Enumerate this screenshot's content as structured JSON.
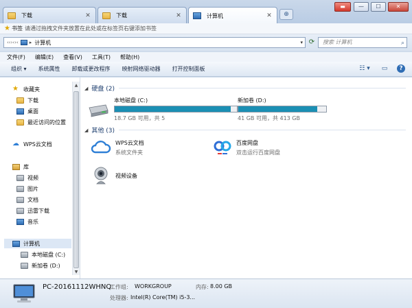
{
  "tabs": [
    {
      "label": "下载",
      "close": "✕",
      "icon": "folder-icon"
    },
    {
      "label": "下载",
      "close": "✕",
      "icon": "folder-icon"
    },
    {
      "label": "计算机",
      "close": "✕",
      "icon": "computer-icon"
    }
  ],
  "new_tab": "⊕",
  "window_controls": {
    "minimize": "—",
    "maximize": "☐",
    "close": "✕",
    "extra": "▬"
  },
  "bookmarks": {
    "label": "书签",
    "hint": "请通过拖拽文件夹放置在此处或在标签页右键添加书签"
  },
  "address": {
    "prefix": "‹‹›‹›‹",
    "separator": "▸",
    "path": "计算机",
    "dropdown": "▾"
  },
  "search": {
    "placeholder": "搜索 计算机",
    "icon": "⌕"
  },
  "menu": [
    "文件(F)",
    "编辑(E)",
    "查看(V)",
    "工具(T)",
    "帮助(H)"
  ],
  "commands": [
    "组织 ▾",
    "系统属性",
    "卸载或更改程序",
    "映射网络驱动器",
    "打开控制面板"
  ],
  "toolbar_icons": {
    "view": "☷ ▾",
    "preview": "▭",
    "help": "?"
  },
  "nav": {
    "favorites": "收藏夹",
    "downloads": "下载",
    "desktop": "桌面",
    "recent": "最近访问的位置",
    "wps": "WPS云文档",
    "libraries": "库",
    "videos": "视频",
    "pictures": "图片",
    "documents": "文档",
    "xunlei": "迅雷下载",
    "music": "音乐",
    "computer": "计算机",
    "local_c": "本地磁盘 (C:)",
    "new_d": "新加卷 (D:)"
  },
  "groups": {
    "hard_disks": "硬盘 (2)",
    "others": "其他 (3)"
  },
  "drives": [
    {
      "name": "本地磁盘 (C:)",
      "free_text": "18.7 GB 可用，共 5",
      "used_fraction": 0.95
    },
    {
      "name": "新加卷 (D:)",
      "free_text": "41 GB 可用，共 413 GB",
      "used_fraction": 0.9
    }
  ],
  "others": [
    {
      "name": "WPS云文档",
      "sub": "系统文件夹",
      "icon": "wps-cloud-icon"
    },
    {
      "name": "百度网盘",
      "sub": "双击运行百度网盘",
      "icon": "baidu-netdisk-icon"
    },
    {
      "name": "视频设备",
      "sub": "",
      "icon": "webcam-icon"
    }
  ],
  "details": {
    "pc_name": "PC-20161112WHNQ",
    "workgroup_label": "工作组:",
    "workgroup": "WORKGROUP",
    "memory_label": "内存:",
    "memory": "8.00 GB",
    "cpu_label": "处理器:",
    "cpu": "Intel(R) Core(TM) i5-3..."
  },
  "colors": {
    "drive_fill": "#1b8fb4",
    "accent": "#2f6db4"
  }
}
